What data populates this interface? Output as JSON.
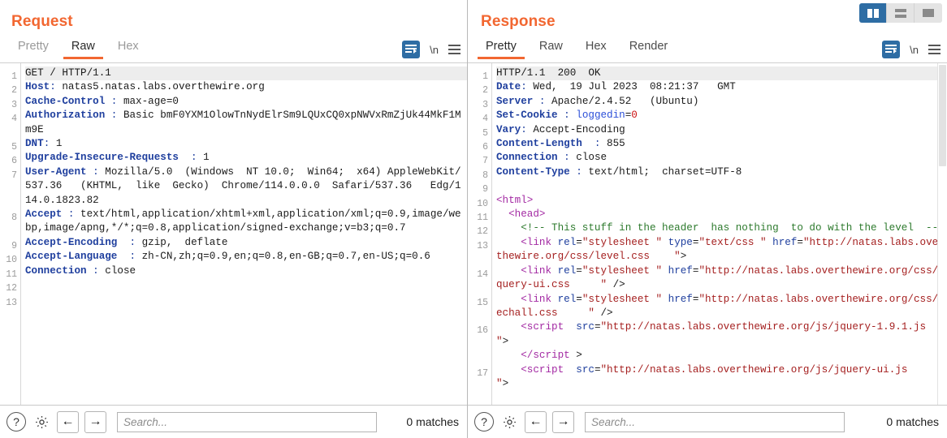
{
  "layout_toggle": {
    "buttons": [
      {
        "name": "split-vertical",
        "active": true
      },
      {
        "name": "split-horizontal",
        "active": false
      },
      {
        "name": "single-pane",
        "active": false
      }
    ]
  },
  "request": {
    "title": "Request",
    "tabs": [
      {
        "label": "Pretty",
        "active": false
      },
      {
        "label": "Raw",
        "active": true
      },
      {
        "label": "Hex",
        "active": false
      }
    ],
    "actions": {
      "wrap_label": "word-wrap",
      "newline_label": "\\n",
      "menu_label": "menu"
    },
    "lines": [
      "1",
      "2",
      "3",
      "4",
      "5",
      "6",
      "7",
      "8",
      "9",
      "10",
      "11",
      "12",
      "13"
    ],
    "content": [
      {
        "n": 1,
        "highlight": true,
        "parts": [
          {
            "t": "GET / HTTP/1.1",
            "c": "val"
          }
        ]
      },
      {
        "n": 2,
        "parts": [
          {
            "t": "Host",
            "c": "hdr"
          },
          {
            "t": ": ",
            "c": "pun"
          },
          {
            "t": "natas5.natas.labs.overthewire.org",
            "c": "val"
          }
        ]
      },
      {
        "n": 3,
        "parts": [
          {
            "t": "Cache-Control",
            "c": "hdr"
          },
          {
            "t": " : ",
            "c": "pun"
          },
          {
            "t": "max-age=0",
            "c": "val"
          }
        ]
      },
      {
        "n": 4,
        "parts": [
          {
            "t": "Authorization",
            "c": "hdr"
          },
          {
            "t": " : ",
            "c": "pun"
          },
          {
            "t": "Basic bmF0YXM1OlowTnNydElrSm9LQUxCQ0xpNWVxRmZjUk44MkF1Mm9E",
            "c": "val"
          }
        ]
      },
      {
        "n": 5,
        "parts": [
          {
            "t": "DNT",
            "c": "hdr"
          },
          {
            "t": ": ",
            "c": "pun"
          },
          {
            "t": "1",
            "c": "val"
          }
        ]
      },
      {
        "n": 6,
        "parts": [
          {
            "t": "Upgrade-Insecure-Requests",
            "c": "hdr"
          },
          {
            "t": "  : ",
            "c": "pun"
          },
          {
            "t": "1",
            "c": "val"
          }
        ]
      },
      {
        "n": 7,
        "parts": [
          {
            "t": "User-Agent",
            "c": "hdr"
          },
          {
            "t": " : ",
            "c": "pun"
          },
          {
            "t": "Mozilla/5.0  (Windows  NT 10.0;  Win64;  x64) AppleWebKit/537.36   (KHTML,  like  Gecko)  Chrome/114.0.0.0  Safari/537.36   Edg/114.0.1823.82",
            "c": "val"
          }
        ]
      },
      {
        "n": 8,
        "parts": [
          {
            "t": "Accept",
            "c": "hdr"
          },
          {
            "t": " : ",
            "c": "pun"
          },
          {
            "t": "text/html,application/xhtml+xml,application/xml;q=0.9,image/webp,image/apng,*/*;q=0.8,application/signed-exchange;v=b3;q=0.7",
            "c": "val"
          }
        ]
      },
      {
        "n": 9,
        "parts": [
          {
            "t": "Accept-Encoding",
            "c": "hdr"
          },
          {
            "t": "  : ",
            "c": "pun"
          },
          {
            "t": "gzip,  deflate",
            "c": "val"
          }
        ]
      },
      {
        "n": 10,
        "parts": [
          {
            "t": "Accept-Language",
            "c": "hdr"
          },
          {
            "t": "  : ",
            "c": "pun"
          },
          {
            "t": "zh-CN,zh;q=0.9,en;q=0.8,en-GB;q=0.7,en-US;q=0.6",
            "c": "val"
          }
        ]
      },
      {
        "n": 11,
        "parts": [
          {
            "t": "Connection",
            "c": "hdr"
          },
          {
            "t": " : ",
            "c": "pun"
          },
          {
            "t": "close",
            "c": "val"
          }
        ]
      },
      {
        "n": 12,
        "parts": []
      },
      {
        "n": 13,
        "parts": []
      }
    ],
    "bottom": {
      "help_label": "?",
      "settings_label": "settings",
      "prev_label": "←",
      "next_label": "→",
      "search_placeholder": "Search...",
      "matches": "0 matches"
    }
  },
  "response": {
    "title": "Response",
    "tabs": [
      {
        "label": "Pretty",
        "active": true
      },
      {
        "label": "Raw",
        "active": false
      },
      {
        "label": "Hex",
        "active": false
      },
      {
        "label": "Render",
        "active": false
      }
    ],
    "actions": {
      "wrap_label": "word-wrap",
      "newline_label": "\\n",
      "menu_label": "menu"
    },
    "content": [
      {
        "n": 1,
        "highlight": true,
        "parts": [
          {
            "t": "HTTP/1.1  200  OK",
            "c": "val"
          }
        ]
      },
      {
        "n": 2,
        "parts": [
          {
            "t": "Date",
            "c": "hdr"
          },
          {
            "t": ": ",
            "c": "pun"
          },
          {
            "t": "Wed,  19 Jul 2023  08:21:37   GMT",
            "c": "val"
          }
        ]
      },
      {
        "n": 3,
        "parts": [
          {
            "t": "Server",
            "c": "hdr"
          },
          {
            "t": " : ",
            "c": "pun"
          },
          {
            "t": "Apache/2.4.52   (Ubuntu)",
            "c": "val"
          }
        ]
      },
      {
        "n": 4,
        "parts": [
          {
            "t": "Set-Cookie",
            "c": "hdr"
          },
          {
            "t": " : ",
            "c": "pun"
          },
          {
            "t": "loggedin",
            "c": "ck"
          },
          {
            "t": "=",
            "c": "val"
          },
          {
            "t": "0",
            "c": "num"
          }
        ]
      },
      {
        "n": 5,
        "parts": [
          {
            "t": "Vary",
            "c": "hdr"
          },
          {
            "t": ": ",
            "c": "pun"
          },
          {
            "t": "Accept-Encoding",
            "c": "val"
          }
        ]
      },
      {
        "n": 6,
        "parts": [
          {
            "t": "Content-Length",
            "c": "hdr"
          },
          {
            "t": "  : ",
            "c": "pun"
          },
          {
            "t": "855",
            "c": "val"
          }
        ]
      },
      {
        "n": 7,
        "parts": [
          {
            "t": "Connection",
            "c": "hdr"
          },
          {
            "t": " : ",
            "c": "pun"
          },
          {
            "t": "close",
            "c": "val"
          }
        ]
      },
      {
        "n": 8,
        "parts": [
          {
            "t": "Content-Type",
            "c": "hdr"
          },
          {
            "t": " : ",
            "c": "pun"
          },
          {
            "t": "text/html;  charset=UTF-8",
            "c": "val"
          }
        ]
      },
      {
        "n": 9,
        "parts": []
      },
      {
        "n": 10,
        "parts": [
          {
            "t": "<html>",
            "c": "tag"
          }
        ]
      },
      {
        "n": 11,
        "parts": [
          {
            "t": "  <head>",
            "c": "tag"
          }
        ]
      },
      {
        "n": 12,
        "parts": [
          {
            "t": "    <!-- This stuff in the header  has nothing  to do with the level  -->",
            "c": "cmt"
          }
        ]
      },
      {
        "n": 13,
        "parts": [
          {
            "t": "    <link",
            "c": "tag"
          },
          {
            "t": " rel",
            "c": "attr"
          },
          {
            "t": "=",
            "c": "val"
          },
          {
            "t": "\"stylesheet \"",
            "c": "str"
          },
          {
            "t": " type",
            "c": "attr"
          },
          {
            "t": "=",
            "c": "val"
          },
          {
            "t": "\"text/css \"",
            "c": "str"
          },
          {
            "t": " href",
            "c": "attr"
          },
          {
            "t": "=",
            "c": "val"
          },
          {
            "t": "\"http://natas.labs.overthewire.org/css/level.css    \"",
            "c": "str"
          },
          {
            "t": ">",
            "c": "val"
          }
        ]
      },
      {
        "n": 14,
        "parts": [
          {
            "t": "    <link",
            "c": "tag"
          },
          {
            "t": " rel",
            "c": "attr"
          },
          {
            "t": "=",
            "c": "val"
          },
          {
            "t": "\"stylesheet \"",
            "c": "str"
          },
          {
            "t": " href",
            "c": "attr"
          },
          {
            "t": "=",
            "c": "val"
          },
          {
            "t": "\"http://natas.labs.overthewire.org/css/jquery-ui.css     \"",
            "c": "str"
          },
          {
            "t": " />",
            "c": "val"
          }
        ]
      },
      {
        "n": 15,
        "parts": [
          {
            "t": "    <link",
            "c": "tag"
          },
          {
            "t": " rel",
            "c": "attr"
          },
          {
            "t": "=",
            "c": "val"
          },
          {
            "t": "\"stylesheet \"",
            "c": "str"
          },
          {
            "t": " href",
            "c": "attr"
          },
          {
            "t": "=",
            "c": "val"
          },
          {
            "t": "\"http://natas.labs.overthewire.org/css/wechall.css     \"",
            "c": "str"
          },
          {
            "t": " />",
            "c": "val"
          }
        ]
      },
      {
        "n": 16,
        "parts": [
          {
            "t": "    <script",
            "c": "tag"
          },
          {
            "t": "  src",
            "c": "attr"
          },
          {
            "t": "=",
            "c": "val"
          },
          {
            "t": "\"http://natas.labs.overthewire.org/js/jquery-1.9.1.js     \"",
            "c": "str"
          },
          {
            "t": ">",
            "c": "val"
          },
          {
            "t": "\n    </script",
            "c": "tag"
          },
          {
            "t": " >",
            "c": "val"
          }
        ]
      },
      {
        "n": 17,
        "parts": [
          {
            "t": "    <script",
            "c": "tag"
          },
          {
            "t": "  src",
            "c": "attr"
          },
          {
            "t": "=",
            "c": "val"
          },
          {
            "t": "\"http://natas.labs.overthewire.org/js/jquery-ui.js     \"",
            "c": "str"
          },
          {
            "t": ">",
            "c": "val"
          }
        ]
      }
    ],
    "bottom": {
      "help_label": "?",
      "settings_label": "settings",
      "prev_label": "←",
      "next_label": "→",
      "search_placeholder": "Search...",
      "matches": "0 matches"
    }
  },
  "colors": {
    "accent": "#f26731",
    "active_blue": "#2e6da4",
    "header_blue": "#1f3f9e",
    "tag_purple": "#a32aa3",
    "string_red": "#a52020",
    "comment_green": "#2d7a2d"
  }
}
